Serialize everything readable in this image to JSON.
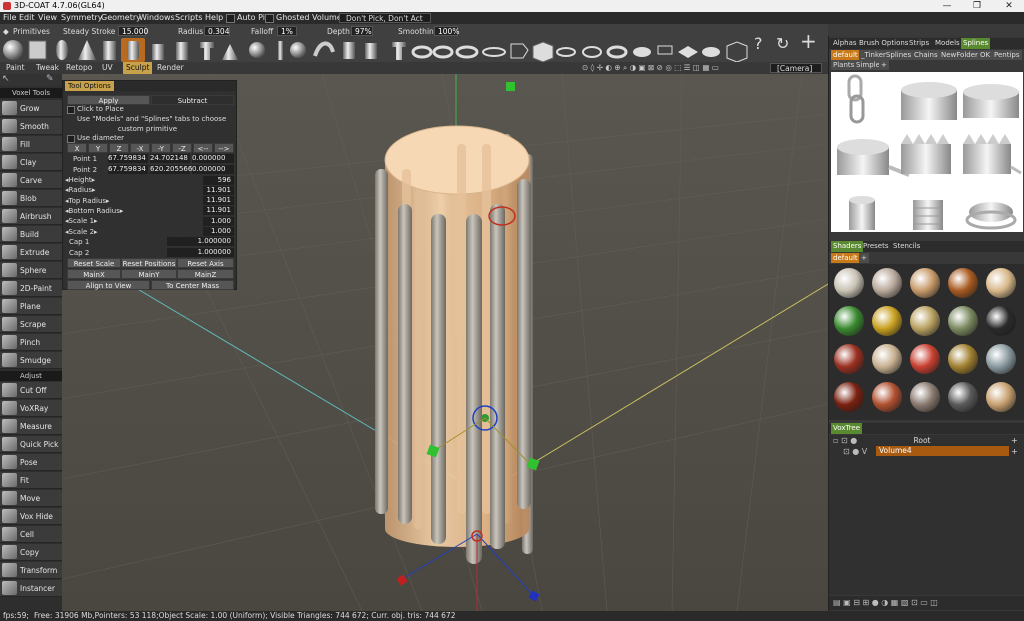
{
  "window": {
    "title": "3D-COAT 4.7.06(GL64)",
    "minimize": "—",
    "maximize": "❐",
    "close": "✕"
  },
  "menu": {
    "items": [
      "File",
      "Edit",
      "View",
      "Symmetry",
      "Geometry",
      "Windows",
      "Scripts",
      "Help"
    ],
    "auto_pick": "Auto Pick",
    "ghosted_volumes": "Ghosted Volumes:",
    "ghost_mode": "Don't Pick, Don't Act"
  },
  "primitives_bar": {
    "title": "Primitives",
    "steady_stroke_label": "Steady Stroke",
    "steady_stroke_value": "15.000",
    "radius_label": "Radius",
    "radius_value": "0.304",
    "falloff_label": "Falloff",
    "falloff_value": "1%",
    "depth_label": "Depth",
    "depth_value": "97%",
    "smoothing_label": "Smoothing",
    "smoothing_value": "100%"
  },
  "rooms": [
    "Paint",
    "Tweak",
    "Retopo",
    "UV",
    "Sculpt",
    "Render"
  ],
  "active_room": "Sculpt",
  "camera_label": "[Camera]",
  "tools": {
    "voxel_header": "Voxel Tools",
    "voxel": [
      "Grow",
      "Smooth",
      "Fill",
      "Clay",
      "Carve",
      "Blob",
      "Airbrush",
      "Build",
      "Extrude",
      "Sphere",
      "2D-Paint",
      "Plane",
      "Scrape",
      "Pinch",
      "Smudge"
    ],
    "adjust_header": "Adjust",
    "adjust": [
      "Cut Off",
      "VoXRay",
      "Measure",
      "Quick Pick",
      "Pose",
      "Fit",
      "Move",
      "Vox Hide",
      "Cell",
      "Copy",
      "Transform",
      "Instancer"
    ]
  },
  "tool_options": {
    "title": "Tool Options",
    "apply": "Apply",
    "mode": "Subtract",
    "click_to_place": "Click to Place",
    "hint_line1": "Use \"Models\" and \"Splines\" tabs to choose",
    "hint_line2": "custom primitive",
    "use_diameter": "Use diameter",
    "axis_buttons": [
      "X",
      "Y",
      "Z",
      "-X",
      "-Y",
      "-Z",
      "<--",
      "-->"
    ],
    "point1_label": "Point 1",
    "point1": [
      "67.759834",
      "24.702148",
      "0.000000"
    ],
    "point2_label": "Point 2",
    "point2": [
      "67.759834",
      "620.205566",
      "0.000000"
    ],
    "params": [
      {
        "label": "Height",
        "value": "596"
      },
      {
        "label": "Radius",
        "value": "11.901"
      },
      {
        "label": "Top Radius",
        "value": "11.901"
      },
      {
        "label": "Bottom Radius",
        "value": "11.901"
      },
      {
        "label": "Scale 1",
        "value": "1.000"
      },
      {
        "label": "Scale 2",
        "value": "1.000"
      }
    ],
    "cap1_label": "Cap 1",
    "cap1": "1.000000",
    "cap2_label": "Cap 2",
    "cap2": "1.000000",
    "reset_scale": "Reset Scale",
    "reset_positions": "Reset Positions",
    "reset_axis": "Reset Axis",
    "mainx": "MainX",
    "mainy": "MainY",
    "mainz": "MainZ",
    "align_to_view": "Align to View",
    "to_center_mass": "To Center Mass"
  },
  "models_panel": {
    "tabs": [
      "Alphas",
      "Brush Options",
      "Strips",
      "Models",
      "Splines"
    ],
    "active_tab": "Splines",
    "subtabs": [
      "default",
      "_TinkerSplines",
      "Chains",
      "NewFolder",
      "OK",
      "Pentips"
    ],
    "subtabs2": [
      "Plants",
      "Simple",
      "+"
    ]
  },
  "shaders_panel": {
    "tabs": [
      "Shaders",
      "Presets",
      "Stencils"
    ],
    "folder": "default",
    "add": "+",
    "ball_colors": [
      "#c9c2b4",
      "#b8a89a",
      "#c79a6a",
      "#a85a20",
      "#d8b88a",
      "#3a8a30",
      "#c8a020",
      "#b8a060",
      "#7a8a60",
      "#2a2a2a",
      "#9a3020",
      "#c8b090",
      "#c84030",
      "#a08030",
      "#8a9aa0",
      "#7a2010",
      "#b05030",
      "#8a7a70",
      "#5a5a5a",
      "#c8a070"
    ]
  },
  "voxtree": {
    "tab": "VoxTree",
    "root": "Root",
    "volume": "Volume4",
    "plus": "+"
  },
  "status": {
    "fps": "fps:59;",
    "info": "Free: 31906 Mb,Pointers: 53 118;Object Scale: 1.00 (Uniform); Visible Triangles: 744 672; Curr. obj. tris: 744 672"
  }
}
